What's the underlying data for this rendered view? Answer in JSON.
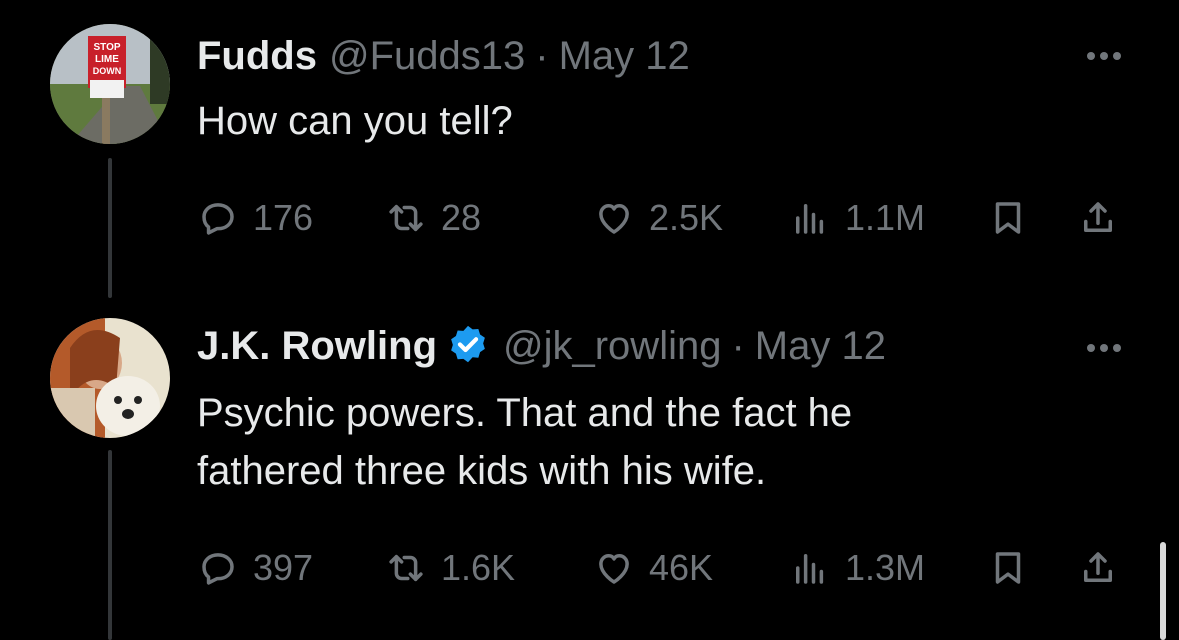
{
  "tweets": [
    {
      "display_name": "Fudds",
      "handle": "@Fudds13",
      "separator": "·",
      "date": "May 12",
      "verified": false,
      "text_lines": [
        "How can you tell?"
      ],
      "avatar_sign": [
        "STOP",
        "LIME",
        "DOWN"
      ],
      "replies": "176",
      "retweets": "28",
      "likes": "2.5K",
      "views": "1.1M"
    },
    {
      "display_name": "J.K. Rowling",
      "handle": "@jk_rowling",
      "separator": "·",
      "date": "May 12",
      "verified": true,
      "text_lines": [
        "Psychic powers. That and the fact he",
        "fathered three kids with his wife."
      ],
      "replies": "397",
      "retweets": "1.6K",
      "likes": "46K",
      "views": "1.3M"
    }
  ],
  "colors": {
    "background": "#000000",
    "text": "#e7e9ea",
    "muted": "#71767b",
    "verified": "#1d9bf0",
    "thread_line": "#333639"
  },
  "icons": [
    "reply-icon",
    "retweet-icon",
    "heart-icon",
    "views-icon",
    "bookmark-icon",
    "share-icon",
    "more-icon",
    "verified-badge-icon"
  ]
}
